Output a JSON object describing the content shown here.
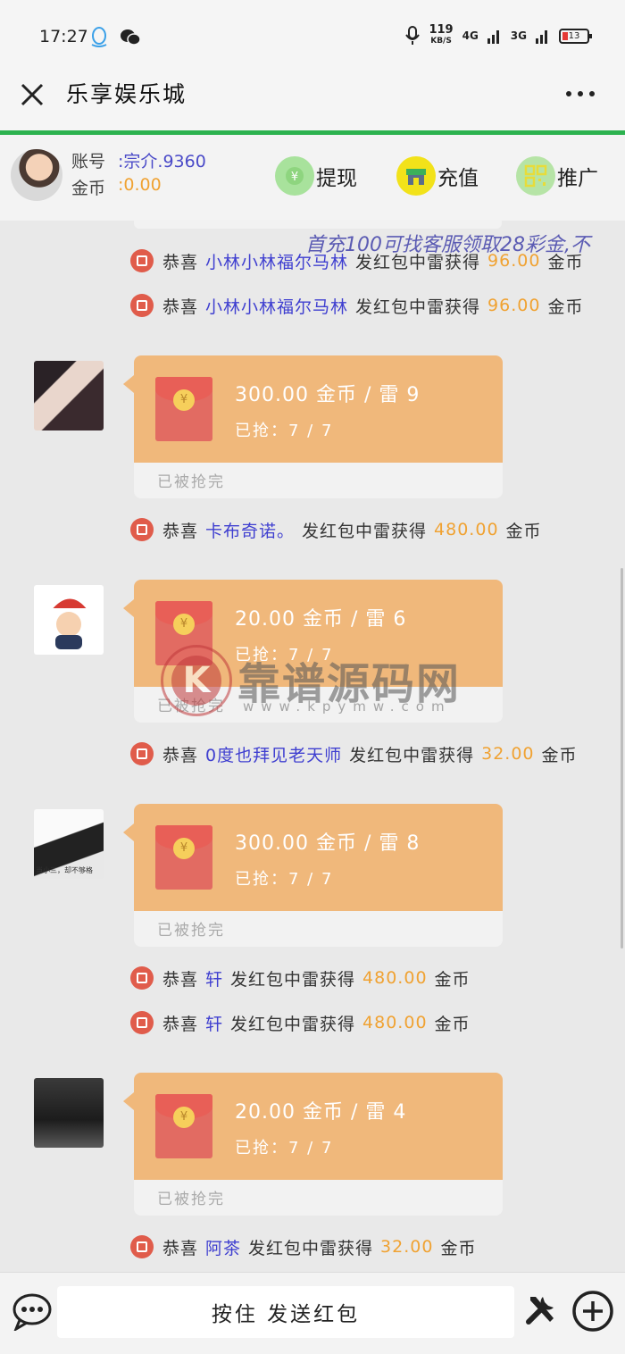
{
  "status_bar": {
    "time": "17:27",
    "speed_value": "119",
    "speed_unit": "KB/S",
    "net1": "4G",
    "net2": "3G",
    "battery": "13"
  },
  "titlebar": {
    "title": "乐享娱乐城"
  },
  "account": {
    "account_label": "账号",
    "account_value": ":宗介.9360",
    "coins_label": "金币",
    "coins_value": ":0.00",
    "withdraw_label": "提现",
    "recharge_label": "充值",
    "promote_label": "推广"
  },
  "marquee": "首充100可找客服领取28彩金,不",
  "messages": [
    {
      "type": "notice",
      "prefix": "恭喜",
      "name": "小林小林福尔马林",
      "middle": "发红包中雷获得",
      "amount": "96.00",
      "suffix": "金币"
    },
    {
      "type": "notice",
      "prefix": "恭喜",
      "name": "小林小林福尔马林",
      "middle": "发红包中雷获得",
      "amount": "96.00",
      "suffix": "金币"
    },
    {
      "type": "redpacket",
      "amount_text": "300.00 金币 / 雷 9",
      "grabbed": "已抢：7 / 7",
      "status": "已被抢完"
    },
    {
      "type": "notice",
      "prefix": "恭喜",
      "name": "卡布奇诺。",
      "middle": "发红包中雷获得",
      "amount": "480.00",
      "suffix": "金币"
    },
    {
      "type": "redpacket",
      "amount_text": "20.00 金币 / 雷 6",
      "grabbed": "已抢：7 / 7",
      "status": "已被抢完"
    },
    {
      "type": "notice",
      "prefix": "恭喜",
      "name": "0度也拜见老天师",
      "middle": "发红包中雷获得",
      "amount": "32.00",
      "suffix": "金币"
    },
    {
      "type": "redpacket",
      "amount_text": "300.00 金币 / 雷 8",
      "grabbed": "已抢：7 / 7",
      "status": "已被抢完",
      "avatar_caption": "当小三，却不够格"
    },
    {
      "type": "notice",
      "prefix": "恭喜",
      "name": "轩",
      "middle": "发红包中雷获得",
      "amount": "480.00",
      "suffix": "金币"
    },
    {
      "type": "notice",
      "prefix": "恭喜",
      "name": "轩",
      "middle": "发红包中雷获得",
      "amount": "480.00",
      "suffix": "金币"
    },
    {
      "type": "redpacket",
      "amount_text": "20.00 金币 / 雷 4",
      "grabbed": "已抢：7 / 7",
      "status": "已被抢完"
    },
    {
      "type": "notice",
      "prefix": "恭喜",
      "name": "阿茶",
      "middle": "发红包中雷获得",
      "amount": "32.00",
      "suffix": "金币"
    }
  ],
  "watermark": {
    "logo_letter": "K",
    "text": "靠谱源码网",
    "url": "www.kpymw.com"
  },
  "bottom": {
    "send_label": "按住 发送红包"
  },
  "colors": {
    "accent_green": "#2cb24f",
    "packet": "#f0b87b",
    "name_blue": "#3f3fd0",
    "amount_orange": "#f0a232"
  }
}
